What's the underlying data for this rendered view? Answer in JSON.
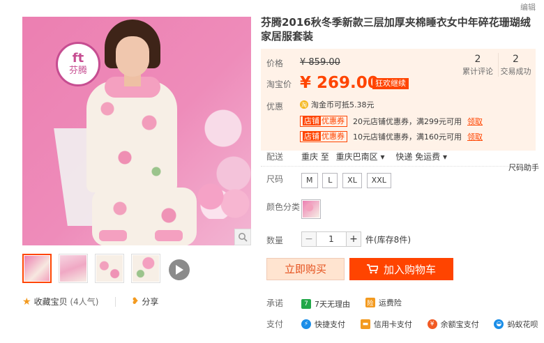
{
  "edit_link": "编辑",
  "brand": {
    "mark": "ft",
    "name": "芬腾"
  },
  "product": {
    "title": "芬腾2016秋冬季新款三层加厚夹棉睡衣女中年碎花珊瑚绒家居服套装"
  },
  "price": {
    "label": "价格",
    "original": "¥ 859.00",
    "promo_label": "淘宝价",
    "promo": "¥ 269.00",
    "promo_badge": "狂欢继续",
    "reviews_count": "2",
    "reviews_label": "累计评论",
    "deals_count": "2",
    "deals_label": "交易成功"
  },
  "offers": {
    "label": "优惠",
    "coin_text": "淘金币可抵5.38元",
    "coupons": [
      {
        "tag_a": "店铺",
        "tag_b": "优惠券",
        "text": "20元店铺优惠券，满299元可用",
        "claim": "领取"
      },
      {
        "tag_a": "店铺",
        "tag_b": "优惠券",
        "text": "10元店铺优惠券，满160元可用",
        "claim": "领取"
      }
    ]
  },
  "delivery": {
    "label": "配送",
    "from": "重庆 至",
    "to": "重庆巴南区",
    "shipping": "快递 免运费"
  },
  "size": {
    "label": "尺码",
    "helper": "尺码助手",
    "options": [
      "M",
      "L",
      "XL",
      "XXL"
    ]
  },
  "color": {
    "label": "颜色分类"
  },
  "quantity": {
    "label": "数量",
    "value": "1",
    "minus": "−",
    "plus": "+",
    "stock": "件(库存8件)"
  },
  "actions": {
    "buy_now": "立即购买",
    "add_to_cart": "加入购物车"
  },
  "guarantee": {
    "label": "承诺",
    "items": [
      {
        "icon": "return-icon",
        "text": "7天无理由",
        "color": "#22a849",
        "glyph": "7"
      },
      {
        "icon": "shipping-insurance-icon",
        "text": "运费险",
        "color": "#f39a1f",
        "glyph": "险"
      }
    ]
  },
  "payment": {
    "label": "支付",
    "items": [
      {
        "text": "快捷支付",
        "color": "#1b8ee8",
        "glyph": "⚡"
      },
      {
        "text": "信用卡支付",
        "color": "#f39a1f",
        "glyph": "▬"
      },
      {
        "text": "余额宝支付",
        "color": "#f15a24",
        "glyph": "¥"
      },
      {
        "text": "蚂蚁花呗",
        "color": "#1b8ee8",
        "glyph": "◒"
      }
    ]
  },
  "social": {
    "favorite": "收藏宝贝",
    "popularity": "(4人气)",
    "share": "分享"
  }
}
